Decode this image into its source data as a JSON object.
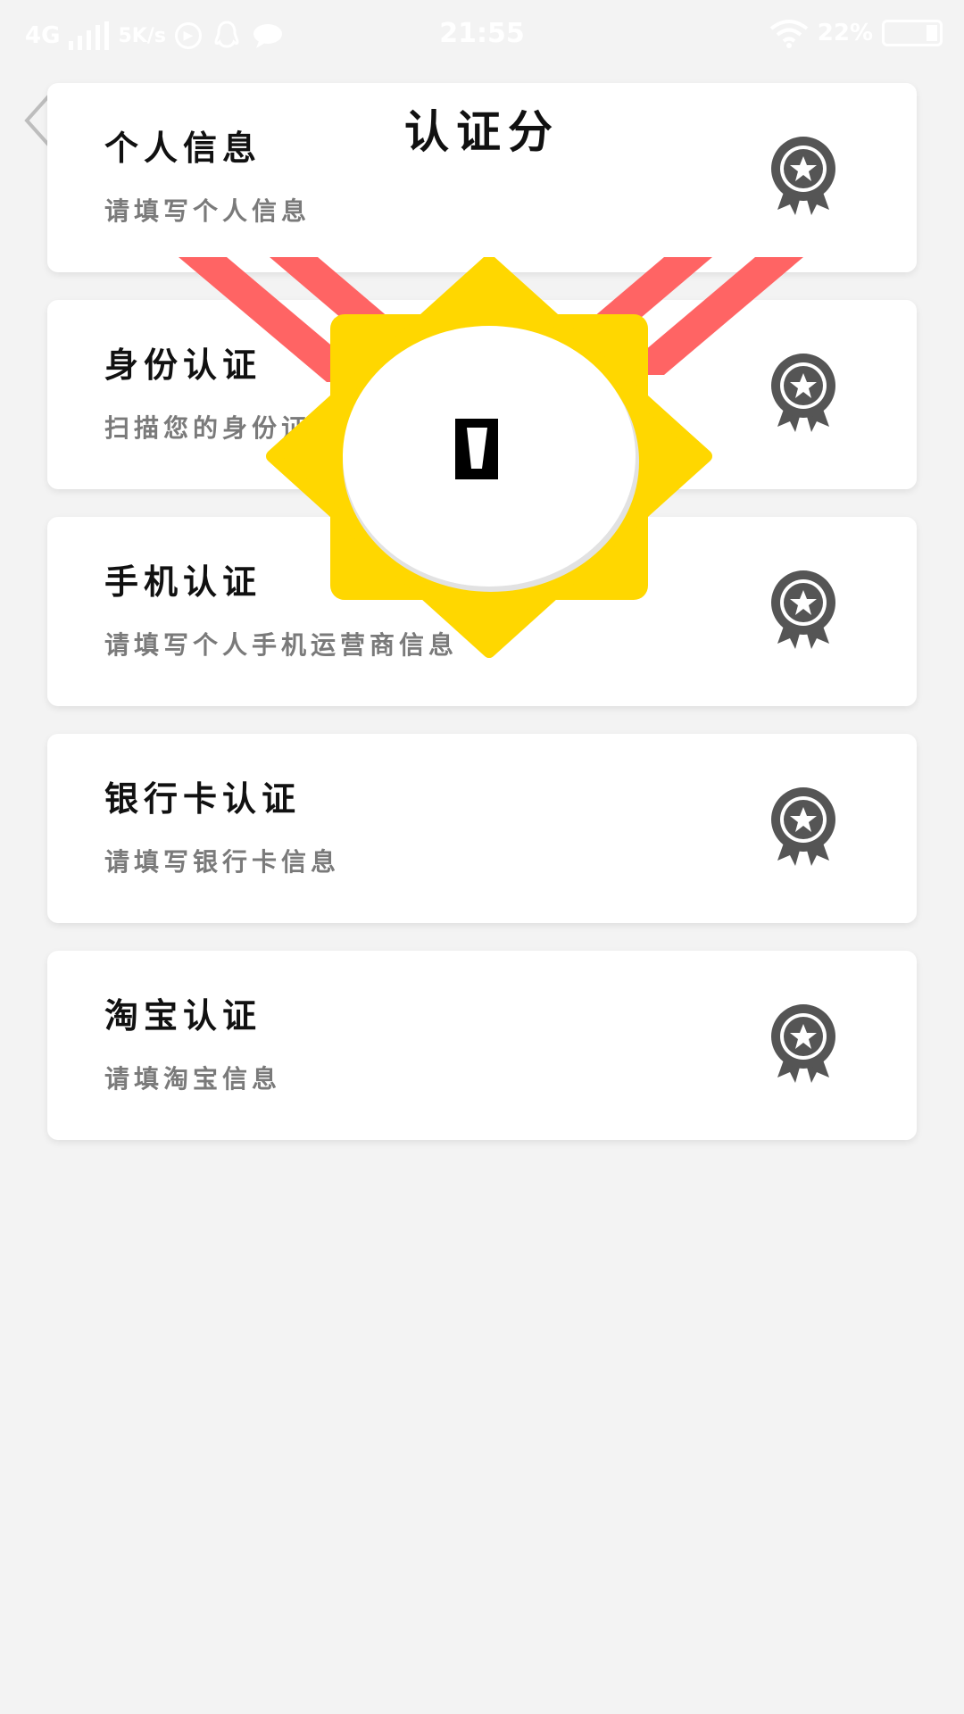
{
  "status_bar": {
    "network": "4G",
    "speed": "5K/s",
    "time": "21:55",
    "battery": "22%"
  },
  "header": {
    "title": "认证分"
  },
  "medal": {
    "score": "0",
    "colors": {
      "ribbon": "#ff6464",
      "star": "#ffd700",
      "center": "#ffffff"
    }
  },
  "cards": [
    {
      "title": "个人信息",
      "subtitle": "请填写个人信息",
      "icon": "medal-star-icon"
    },
    {
      "title": "身份认证",
      "subtitle": "扫描您的身份证",
      "icon": "medal-star-icon"
    },
    {
      "title": "手机认证",
      "subtitle": "请填写个人手机运营商信息",
      "icon": "medal-star-icon"
    },
    {
      "title": "银行卡认证",
      "subtitle": "请填写银行卡信息",
      "icon": "medal-star-icon"
    },
    {
      "title": "淘宝认证",
      "subtitle": "请填淘宝信息",
      "icon": "medal-star-icon"
    }
  ],
  "colors": {
    "background": "#f3f3f3",
    "card": "#ffffff",
    "badge": "#555555"
  }
}
